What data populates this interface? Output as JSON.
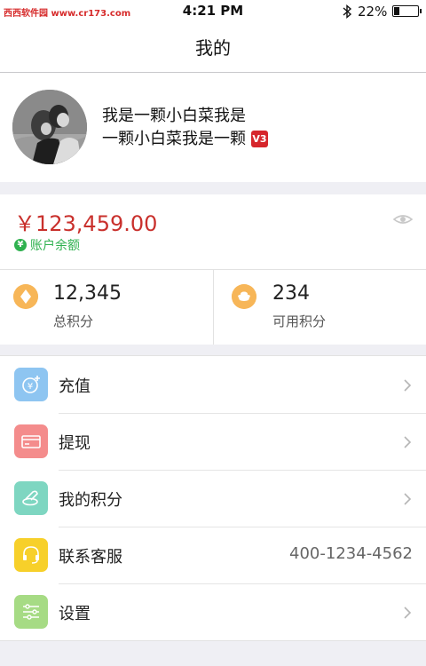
{
  "status_bar": {
    "watermark_site": "西西软件园",
    "watermark_url": "www.cr173.com",
    "time": "4:21 PM",
    "battery_percent": "22%",
    "battery_level": 0.22,
    "icons": [
      "bluetooth-icon",
      "battery-icon"
    ]
  },
  "nav": {
    "title": "我的"
  },
  "profile": {
    "name_line1": "我是一颗小白菜我是",
    "name_line2": "一颗小白菜我是一颗",
    "vip_badge": "V3"
  },
  "balance": {
    "amount": "￥123,459.00",
    "currency_icon": "¥",
    "label": "账户余额",
    "accent_color": "#c9302c",
    "label_color": "#2fb14f"
  },
  "points": [
    {
      "value": "12,345",
      "label": "总积分",
      "icon": "points-diamond-icon"
    },
    {
      "value": "234",
      "label": "可用积分",
      "icon": "ingot-icon"
    }
  ],
  "menu": [
    {
      "label": "充值",
      "icon": "recharge-icon",
      "icon_color": "#8ec5f1",
      "value": ""
    },
    {
      "label": "提现",
      "icon": "card-icon",
      "icon_color": "#f48c8c",
      "value": ""
    },
    {
      "label": "我的积分",
      "icon": "coins-icon",
      "icon_color": "#7ed6c1",
      "value": ""
    },
    {
      "label": "联系客服",
      "icon": "headset-icon",
      "icon_color": "#f7d02a",
      "value": "400-1234-4562"
    },
    {
      "label": "设置",
      "icon": "settings-sliders-icon",
      "icon_color": "#a6db84",
      "value": ""
    }
  ]
}
